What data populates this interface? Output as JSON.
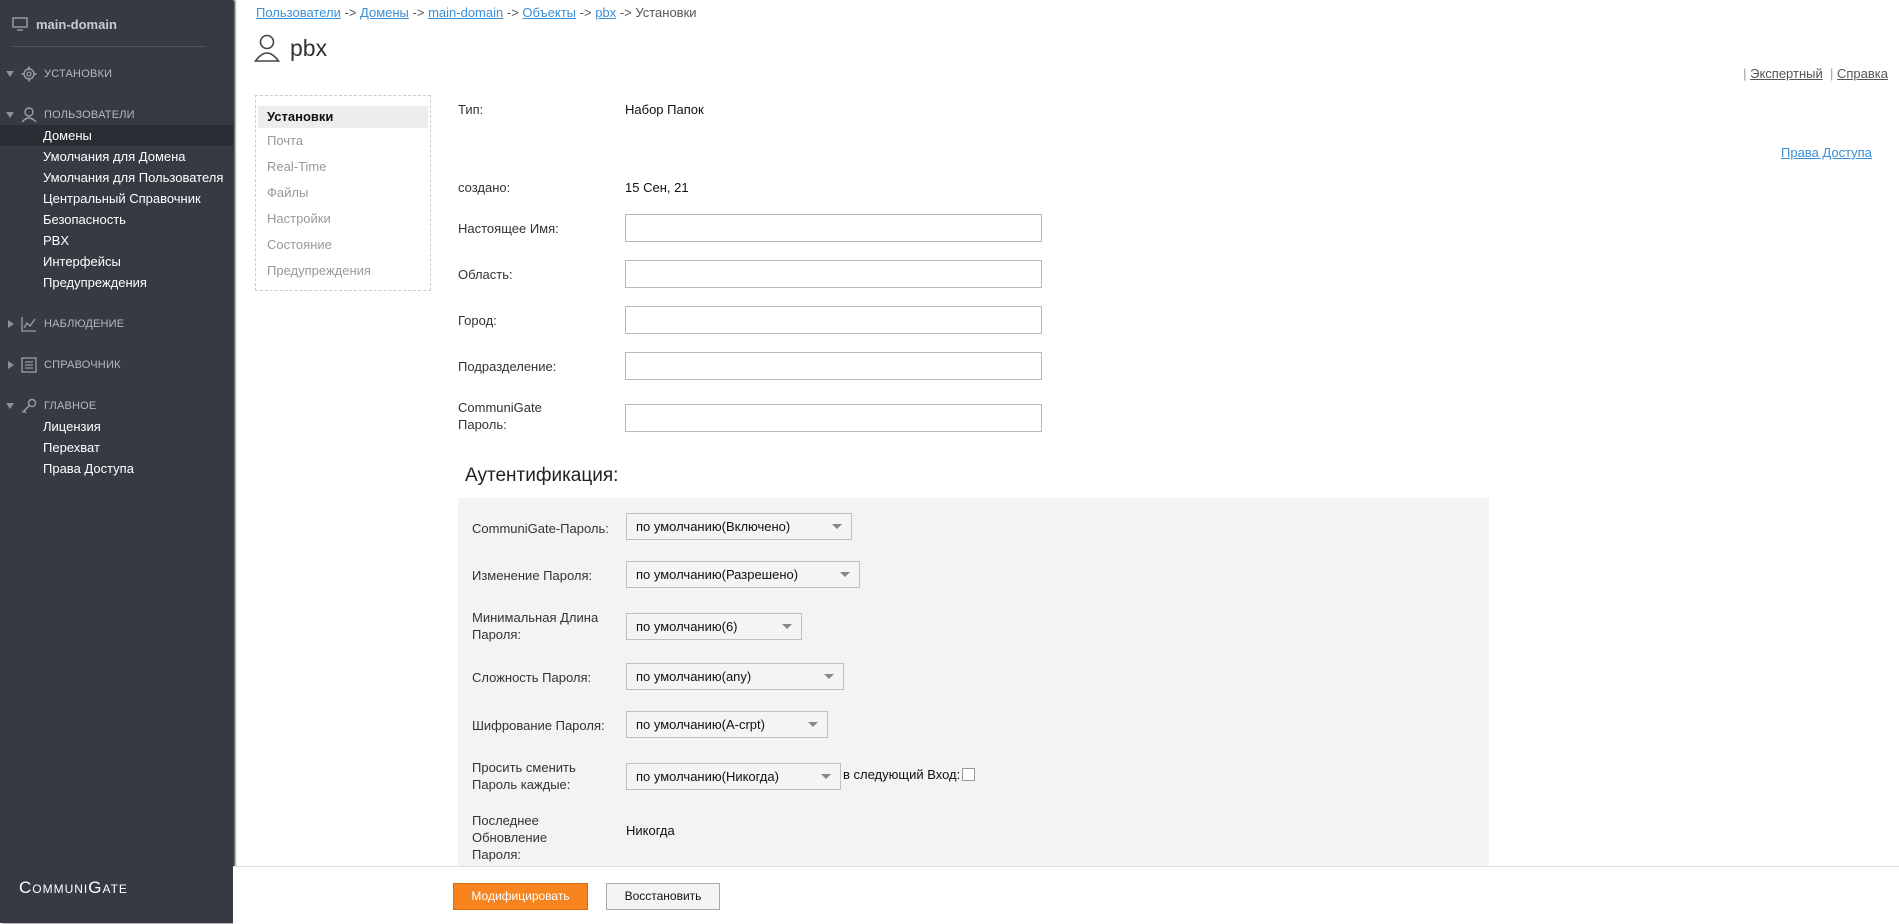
{
  "sidebar": {
    "domain": "main-domain",
    "sections": [
      {
        "label": "Установки",
        "icon": "gear-icon",
        "expanded": false
      },
      {
        "label": "Пользователи",
        "icon": "user-icon",
        "expanded": true,
        "items": [
          "Домены",
          "Умолчания для Домена",
          "Умолчания для Пользователя",
          "Центральный Справочник",
          "Безопасность",
          "PBX",
          "Интерфейсы",
          "Предупреждения"
        ]
      },
      {
        "label": "Наблюдение",
        "icon": "chart-icon",
        "expanded": false
      },
      {
        "label": "Справочник",
        "icon": "directory-icon",
        "expanded": false
      },
      {
        "label": "Главное",
        "icon": "key-icon",
        "expanded": true,
        "items": [
          "Лицензия",
          "Перехват",
          "Права Доступа"
        ]
      }
    ],
    "logo": "CommuniGate"
  },
  "breadcrumb": {
    "links": [
      "Пользователи",
      "Домены",
      "main-domain",
      "Объекты",
      "pbx"
    ],
    "separator": "->",
    "current": "Установки"
  },
  "page_title": "pbx",
  "top_links": {
    "expert": "Экспертный",
    "help": "Справка",
    "sep": "|"
  },
  "rights_link": "Права Доступа",
  "tabs": [
    "Установки",
    "Почта",
    "Real-Time",
    "Файлы",
    "Настройки",
    "Состояние",
    "Предупреждения"
  ],
  "fields": {
    "type_label": "Тип:",
    "type_value": "Набор Папок",
    "created_label": "создано:",
    "created_value": "15 Сен, 21",
    "real_name_label": "Настоящее Имя:",
    "region_label": "Область:",
    "city_label": "Город:",
    "department_label": "Подразделение:",
    "password_label": "CommuniGate Пароль:",
    "real_name_value": "",
    "region_value": "",
    "city_value": "",
    "department_value": "",
    "password_value": ""
  },
  "auth": {
    "title": "Аутентификация:",
    "cg_password_label": "CommuniGate-Пароль:",
    "cg_password_value": "по умолчанию(Включено)",
    "change_label": "Изменение Пароля:",
    "change_value": "по умолчанию(Разрешено)",
    "minlen_label": "Минимальная Длина Пароля:",
    "minlen_value": "по умолчанию(6)",
    "complexity_label": "Сложность Пароля:",
    "complexity_value": "по умолчанию(any)",
    "encryption_label": "Шифрование Пароля:",
    "encryption_value": "по умолчанию(A-crpt)",
    "ask_change_label": "Просить сменить Пароль каждые:",
    "ask_change_value": "по умолчанию(Никогда)",
    "next_login_label": "в следующий Вход:",
    "last_update_label": "Последнее Обновление Пароля:",
    "last_update_value": "Никогда"
  },
  "buttons": {
    "modify": "Модифицировать",
    "restore": "Восстановить"
  }
}
